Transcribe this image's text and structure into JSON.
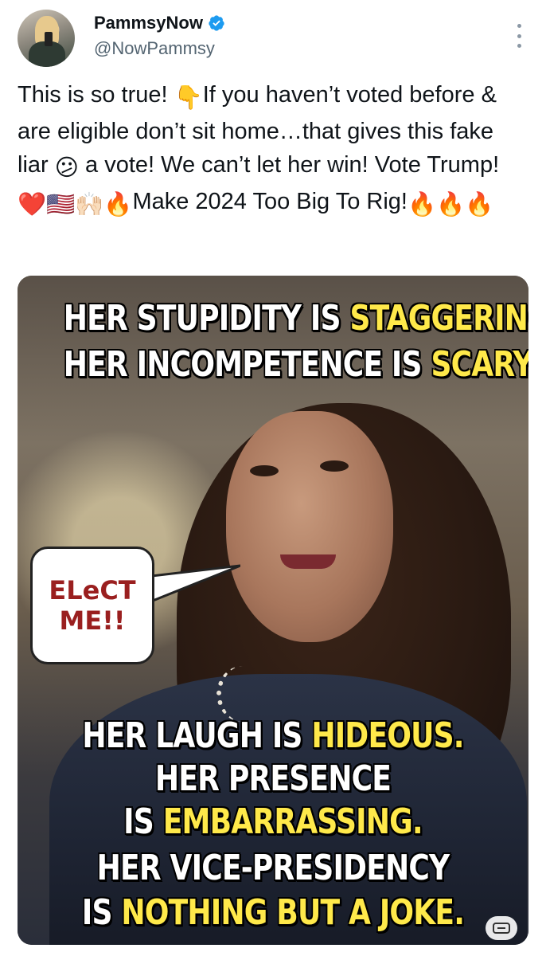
{
  "author": {
    "display_name": "PammsyNow",
    "handle": "@NowPammsy"
  },
  "tweet": {
    "segments": [
      {
        "text": "This is so true! "
      },
      {
        "emoji": "👇"
      },
      {
        "text": "If you haven’t voted before & are eligible don’t sit home…that gives this fake liar "
      },
      {
        "emoji": "😕"
      },
      {
        "text": " a vote! We can’t let her win! Vote Trump!"
      },
      {
        "emoji": "❤️🇺🇸🙌🏻🔥"
      },
      {
        "text": "Make 2024 Too Big To Rig!"
      },
      {
        "emoji": "🔥🔥🔥"
      }
    ]
  },
  "meme": {
    "top_line1_a": "HER STUPIDITY IS ",
    "top_line1_b": "STAGGERING.",
    "top_line2_a": "HER INCOMPETENCE IS ",
    "top_line2_b": "SCARY.",
    "bubble_line1": "ELeCT",
    "bubble_line2": "ME!!",
    "bot_line1_a": "HER LAUGH IS ",
    "bot_line1_b": "HIDEOUS.",
    "bot_line2": "HER PRESENCE",
    "bot_line3_a": "IS ",
    "bot_line3_b": "EMBARRASSING.",
    "bot_line4": "HER VICE-PRESIDENCY",
    "bot_line5_a": "IS ",
    "bot_line5_b": "NOTHING BUT A JOKE."
  },
  "colors": {
    "verified_blue": "#1d9bf0",
    "highlight_yellow": "#ffe94a",
    "bubble_text_red": "#9a1f1f"
  },
  "icons": [
    "verified-badge-icon",
    "more-options-icon",
    "alt-text-icon"
  ]
}
